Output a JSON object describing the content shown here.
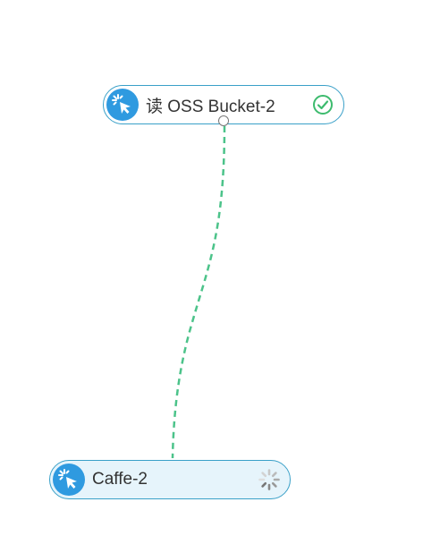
{
  "canvas": {
    "nodes": [
      {
        "label": "读 OSS Bucket-2",
        "icon": "cursor-click-icon",
        "status": "success",
        "status_icon": "check-circle-icon",
        "status_color": "#3dbb6e"
      },
      {
        "label": "Caffe-2",
        "icon": "cursor-click-icon",
        "status": "running",
        "status_icon": "loading-spinner-icon",
        "status_color": "#9a9a9a"
      }
    ],
    "edge": {
      "style": "dashed",
      "color": "#4cc38a"
    },
    "colors": {
      "node_border": "#3aa0c8",
      "icon_bg": "#2f9ae0",
      "running_node_bg": "#e6f4fb"
    }
  }
}
